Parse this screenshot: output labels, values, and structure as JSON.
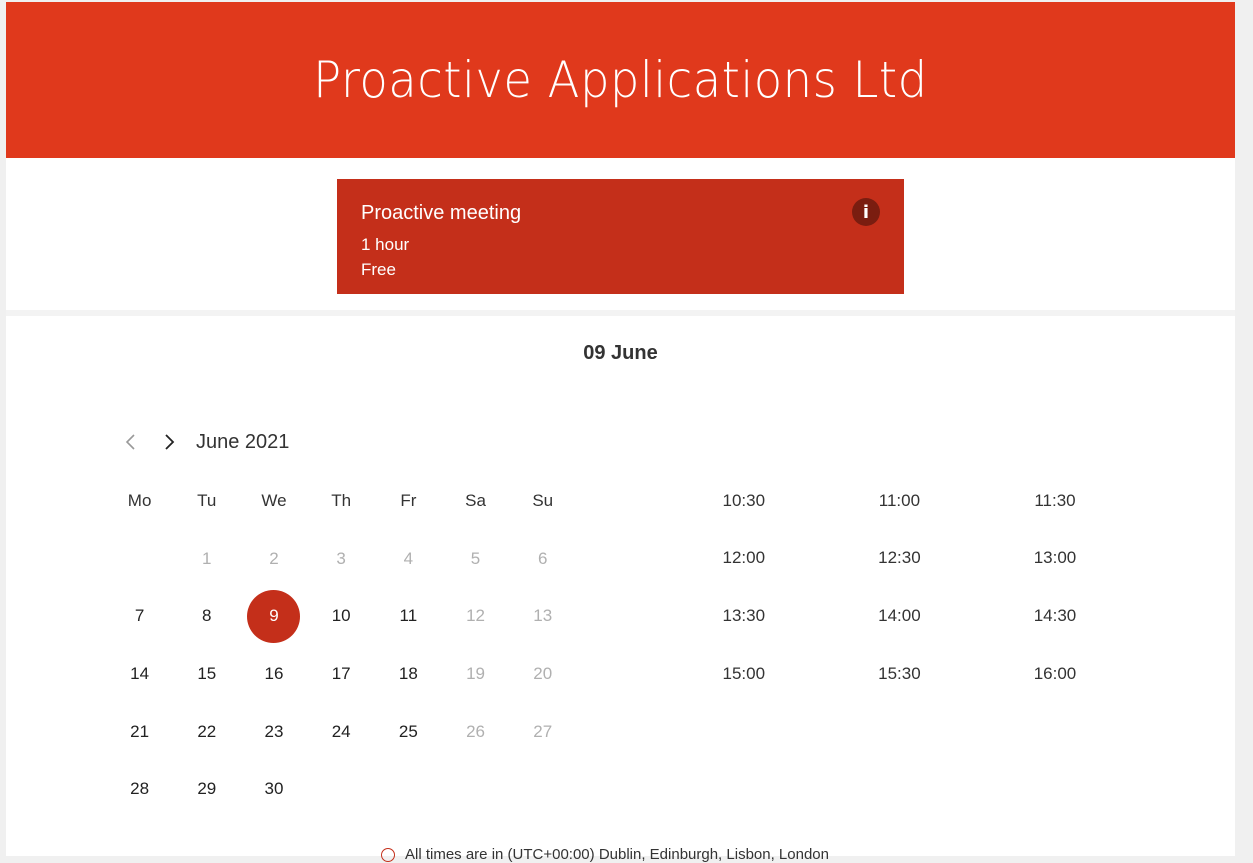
{
  "header": {
    "title": "Proactive Applications Ltd"
  },
  "service": {
    "name": "Proactive meeting",
    "duration": "1 hour",
    "price": "Free",
    "info_icon": "info-icon"
  },
  "selected_date_label": "09 June",
  "calendar": {
    "month_label": "June 2021",
    "prev_icon": "chevron-left-icon",
    "next_icon": "chevron-right-icon",
    "weekdays": [
      "Mo",
      "Tu",
      "We",
      "Th",
      "Fr",
      "Sa",
      "Su"
    ],
    "weeks": [
      [
        null,
        {
          "d": "1",
          "dis": true
        },
        {
          "d": "2",
          "dis": true
        },
        {
          "d": "3",
          "dis": true
        },
        {
          "d": "4",
          "dis": true
        },
        {
          "d": "5",
          "dis": true
        },
        {
          "d": "6",
          "dis": true
        }
      ],
      [
        {
          "d": "7"
        },
        {
          "d": "8"
        },
        {
          "d": "9",
          "sel": true
        },
        {
          "d": "10"
        },
        {
          "d": "11"
        },
        {
          "d": "12",
          "dis": true
        },
        {
          "d": "13",
          "dis": true
        }
      ],
      [
        {
          "d": "14"
        },
        {
          "d": "15"
        },
        {
          "d": "16"
        },
        {
          "d": "17"
        },
        {
          "d": "18"
        },
        {
          "d": "19",
          "dis": true
        },
        {
          "d": "20",
          "dis": true
        }
      ],
      [
        {
          "d": "21"
        },
        {
          "d": "22"
        },
        {
          "d": "23"
        },
        {
          "d": "24"
        },
        {
          "d": "25"
        },
        {
          "d": "26",
          "dis": true
        },
        {
          "d": "27",
          "dis": true
        }
      ],
      [
        {
          "d": "28"
        },
        {
          "d": "29"
        },
        {
          "d": "30"
        },
        null,
        null,
        null,
        null
      ]
    ]
  },
  "time_slots": [
    [
      "10:30",
      "11:00",
      "11:30"
    ],
    [
      "12:00",
      "12:30",
      "13:00"
    ],
    [
      "13:30",
      "14:00",
      "14:30"
    ],
    [
      "15:00",
      "15:30",
      "16:00"
    ]
  ],
  "timezone_note": "All times are in (UTC+00:00) Dublin, Edinburgh, Lisbon, London",
  "colors": {
    "brand": "#e0391c",
    "accent": "#c42f1a",
    "disabled": "#b0b0b0"
  }
}
